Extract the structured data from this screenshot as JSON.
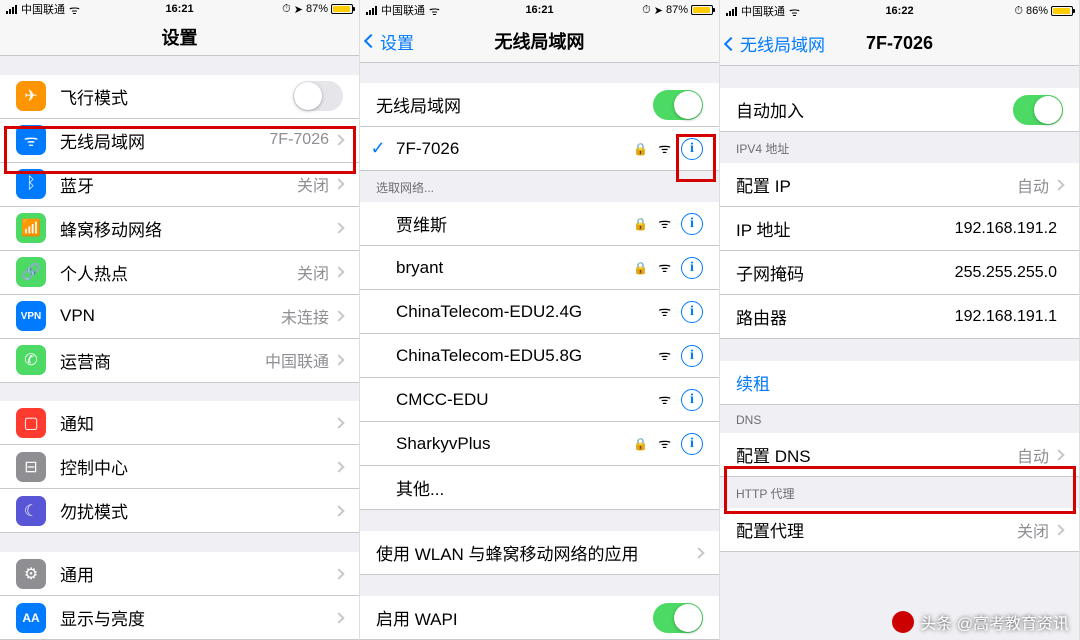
{
  "status": {
    "carrier": "中国联通",
    "time1": "16:21",
    "time2": "16:21",
    "time3": "16:22",
    "battery1": "87%",
    "battery2": "87%",
    "battery3": "86%"
  },
  "screen1": {
    "title": "设置",
    "rows": {
      "airplane": "飞行模式",
      "wifi": "无线局域网",
      "wifi_value": "7F-7026",
      "bt": "蓝牙",
      "bt_value": "关闭",
      "cell": "蜂窝移动网络",
      "hotspot": "个人热点",
      "hotspot_value": "关闭",
      "vpn": "VPN",
      "vpn_value": "未连接",
      "carrier": "运营商",
      "carrier_value": "中国联通",
      "notif": "通知",
      "control": "控制中心",
      "dnd": "勿扰模式",
      "general": "通用",
      "display": "显示与亮度"
    }
  },
  "screen2": {
    "back": "设置",
    "title": "无线局域网",
    "wlan_label": "无线局域网",
    "connected": "7F-7026",
    "choose_header": "选取网络...",
    "nets": [
      "贾维斯",
      "bryant",
      "ChinaTelecom-EDU2.4G",
      "ChinaTelecom-EDU5.8G",
      "CMCC-EDU",
      "SharkyvPlus",
      "其他..."
    ],
    "apps_label": "使用 WLAN 与蜂窝移动网络的应用",
    "wapi_label": "启用 WAPI"
  },
  "screen3": {
    "back": "无线局域网",
    "title": "7F-7026",
    "auto_join": "自动加入",
    "ipv4_header": "IPV4 地址",
    "configure_ip": "配置 IP",
    "configure_ip_value": "自动",
    "ip_addr": "IP 地址",
    "ip_addr_value": "192.168.191.2",
    "subnet": "子网掩码",
    "subnet_value": "255.255.255.0",
    "router": "路由器",
    "router_value": "192.168.191.1",
    "renew": "续租",
    "dns_header": "DNS",
    "configure_dns": "配置 DNS",
    "configure_dns_value": "自动",
    "http_header": "HTTP 代理",
    "configure_proxy": "配置代理",
    "configure_proxy_value": "关闭"
  },
  "footer": "头条 @高考教育资讯"
}
